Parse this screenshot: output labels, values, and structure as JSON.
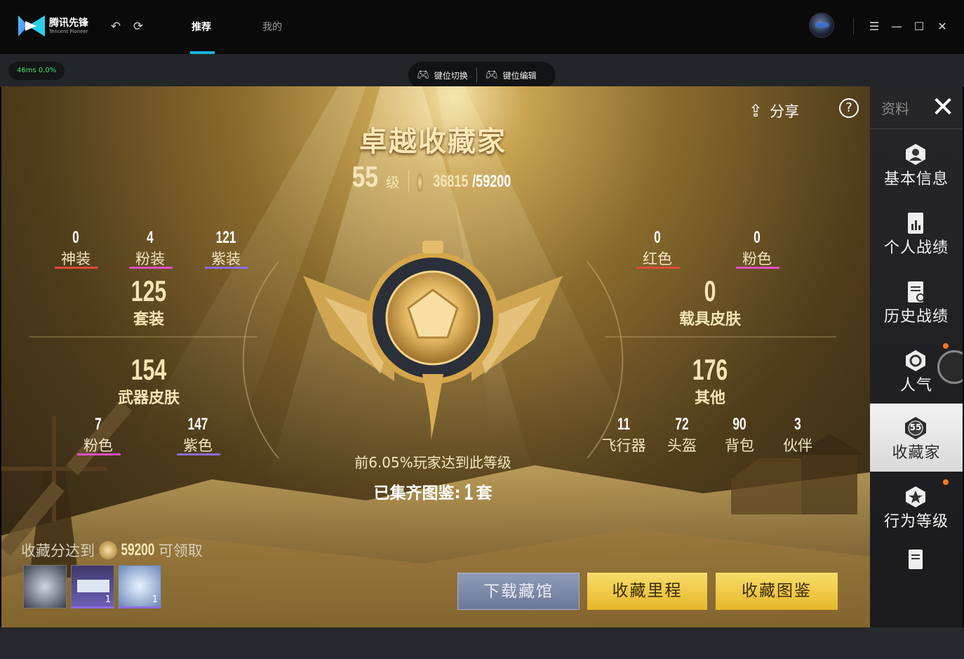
{
  "app": {
    "logo_title": "腾讯先锋",
    "logo_subtitle": "Tencent Pioneer",
    "tabs": [
      {
        "label": "推荐",
        "active": true
      },
      {
        "label": "我的",
        "active": false
      }
    ],
    "accent_color": "#18b3d8"
  },
  "toolbar": {
    "ping_ms": "46ms",
    "loss": "0.0%",
    "key_switch": "键位切换",
    "key_edit": "键位编辑"
  },
  "game": {
    "share_label": "分享",
    "title": "卓越收藏家",
    "level_number": "55",
    "level_unit": "级",
    "points_current": "36815",
    "points_total": "/59200",
    "left_stats": {
      "top": [
        {
          "value": "0",
          "label": "神装",
          "color": "#e24a3b"
        },
        {
          "value": "4",
          "label": "粉装",
          "color": "#e04fc8"
        },
        {
          "value": "121",
          "label": "紫装",
          "color": "#8d6ce0"
        }
      ],
      "suit_value": "125",
      "suit_label": "套装",
      "weapon_value": "154",
      "weapon_label": "武器皮肤",
      "bottom": [
        {
          "value": "7",
          "label": "粉色",
          "color": "#e04fc8"
        },
        {
          "value": "147",
          "label": "紫色",
          "color": "#8d6ce0"
        }
      ]
    },
    "right_stats": {
      "top": [
        {
          "value": "0",
          "label": "红色",
          "color": "#e24a3b"
        },
        {
          "value": "0",
          "label": "粉色",
          "color": "#e04fc8"
        }
      ],
      "vehicle_value": "0",
      "vehicle_label": "载具皮肤",
      "other_value": "176",
      "other_label": "其他",
      "bottom": [
        {
          "value": "11",
          "label": "飞行器"
        },
        {
          "value": "72",
          "label": "头盔"
        },
        {
          "value": "90",
          "label": "背包"
        },
        {
          "value": "3",
          "label": "伙伴"
        }
      ]
    },
    "rank_text": "前6.05%玩家达到此等级",
    "atlas_prefix": "已集齐图鉴:",
    "atlas_count": "1",
    "atlas_unit": "套",
    "reward_prefix": "收藏分达到",
    "reward_points": "59200",
    "reward_suffix": "可领取",
    "reward_items": [
      {
        "badge": ""
      },
      {
        "badge": "1"
      },
      {
        "badge": "1"
      }
    ],
    "buttons": {
      "download": "下载藏馆",
      "milestone": "收藏里程",
      "atlas": "收藏图鉴"
    }
  },
  "side_panel": {
    "header": "资料",
    "items": [
      {
        "label": "基本信息",
        "icon": "person-icon"
      },
      {
        "label": "个人战绩",
        "icon": "chart-doc-icon"
      },
      {
        "label": "历史战绩",
        "icon": "history-doc-icon"
      },
      {
        "label": "人气",
        "icon": "popularity-icon"
      },
      {
        "label": "收藏家",
        "icon": "collector-badge-icon",
        "badge": "55",
        "active": true
      },
      {
        "label": "行为等级",
        "icon": "behavior-icon"
      },
      {
        "label": "",
        "icon": "document-icon"
      }
    ]
  }
}
